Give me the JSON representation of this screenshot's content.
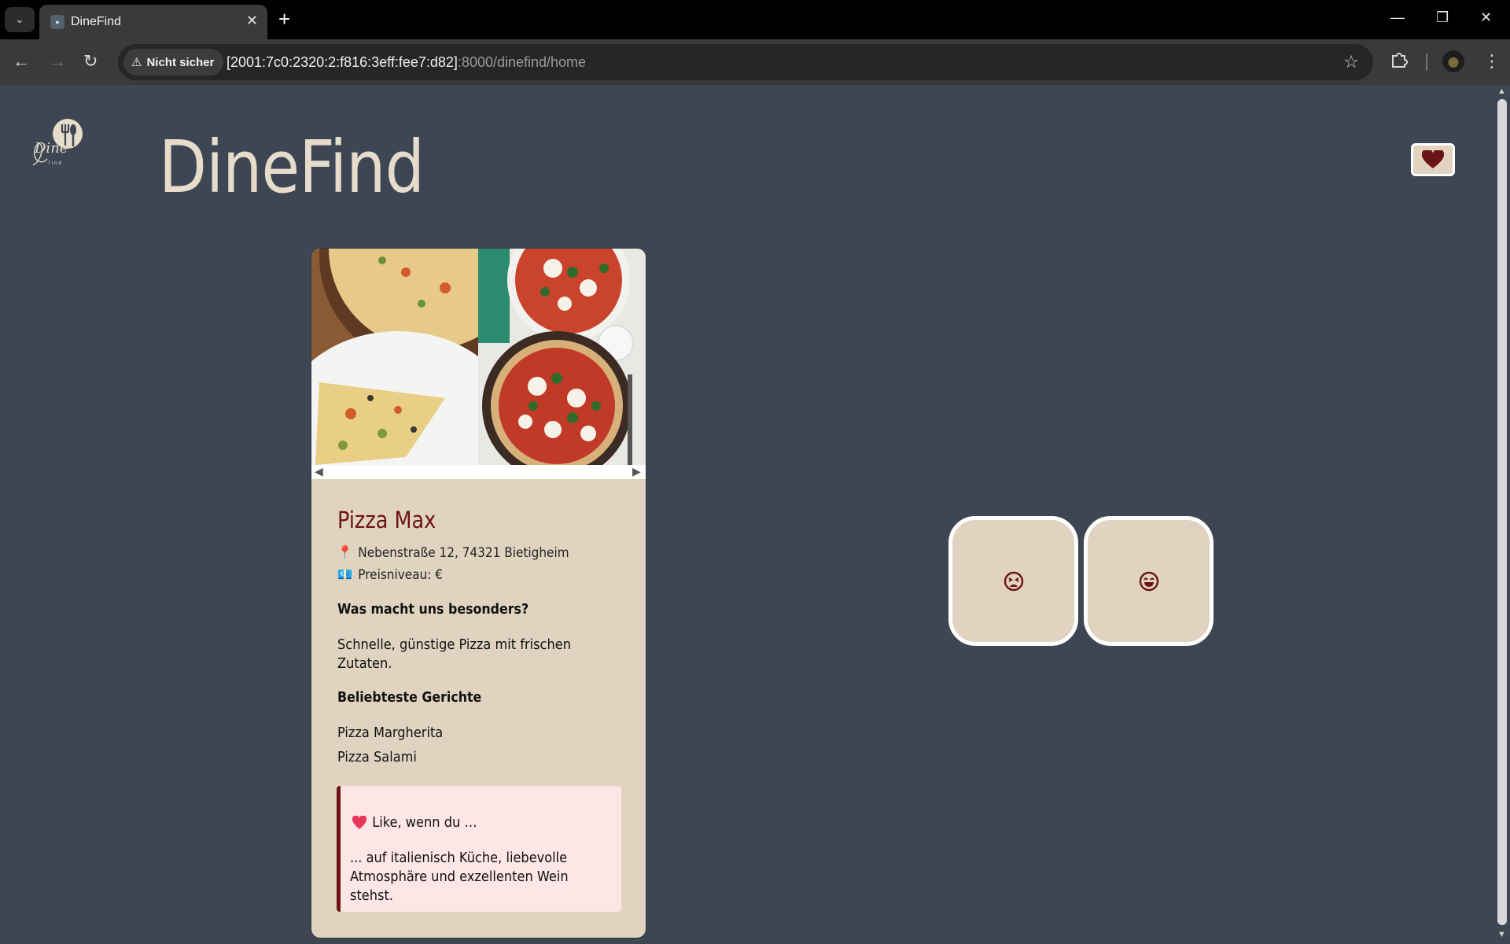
{
  "browser": {
    "tab_title": "DineFind",
    "security_label": "Nicht sicher",
    "url_host": "[2001:7c0:2320:2:f816:3eff:fee7:d82]",
    "url_rest": ":8000/dinefind/home"
  },
  "app": {
    "logo_text": "Dine",
    "logo_subtext": "find",
    "title": "DineFind"
  },
  "restaurant": {
    "name": "Pizza Max",
    "address": "Nebenstraße 12, 74321 Bietigheim",
    "price_level": "Preisniveau: €",
    "special_heading": "Was macht uns besonders?",
    "special_text": "Schnelle, günstige Pizza mit frischen Zutaten.",
    "dishes_heading": "Beliebteste Gerichte",
    "dishes": [
      "Pizza Margherita",
      "Pizza Salami"
    ],
    "like_heading": "Like, wenn du …",
    "like_text": "... auf italienisch Küche, liebevolle Atmosphäre und exzellenten Wein stehst."
  },
  "colors": {
    "page_bg": "#3e4653",
    "card_bg": "#e0d4c0",
    "accent": "#6b1416",
    "like_bg": "#fde6e6"
  }
}
